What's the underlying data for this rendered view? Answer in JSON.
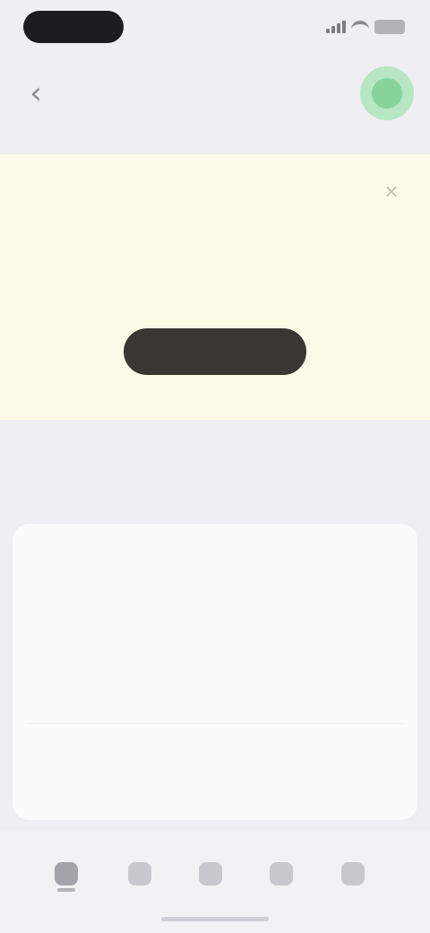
{
  "status_bar": {
    "time": "",
    "signal_icon": "signal-icon",
    "wifi_icon": "wifi-icon",
    "battery_icon": "battery-icon"
  },
  "header": {
    "back_icon": "‹",
    "title": "",
    "avatar_icon": "avatar-icon"
  },
  "banner": {
    "close_icon": "×",
    "title": "",
    "text": "",
    "button_label": "",
    "background": "#fdfbe8",
    "button_color": "#3a3732"
  },
  "section": {
    "label": ""
  },
  "card": {
    "lines": [
      "",
      "",
      "",
      "",
      ""
    ],
    "meta": "",
    "subtext": ""
  },
  "tabbar": {
    "tabs": [
      {
        "icon": "home-icon"
      },
      {
        "icon": "search-icon"
      },
      {
        "icon": "add-icon"
      },
      {
        "icon": "notifications-icon"
      },
      {
        "icon": "profile-icon"
      }
    ]
  }
}
